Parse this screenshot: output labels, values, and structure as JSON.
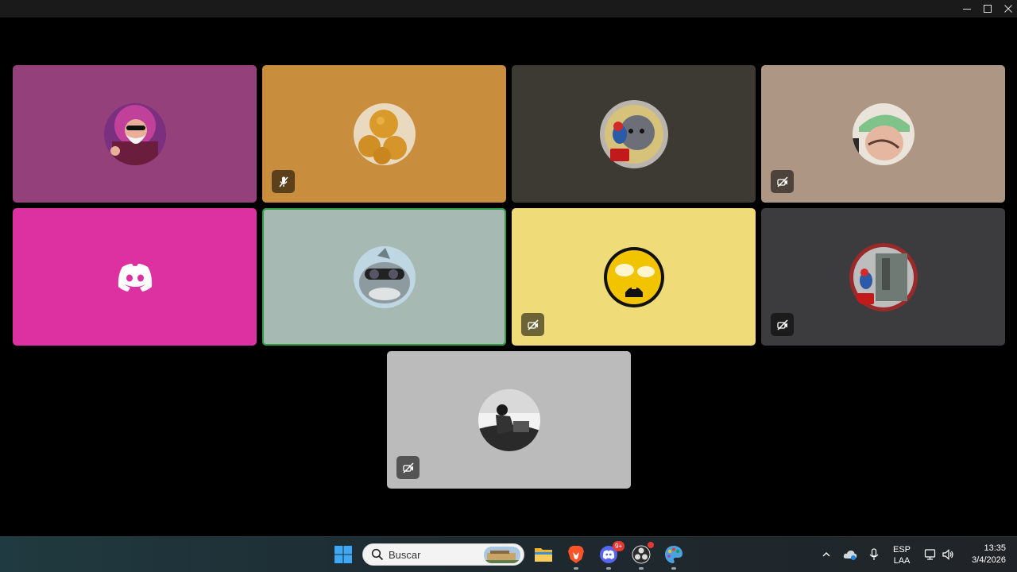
{
  "window": {
    "controls": [
      "minimize",
      "maximize",
      "close"
    ],
    "icons": {
      "minimize": "minimize-icon",
      "maximize": "maximize-icon",
      "close": "close-icon"
    }
  },
  "call": {
    "participants": [
      {
        "id": "p1",
        "tile_color": "#94407b",
        "avatar": "old-master-with-sunglasses",
        "mic_muted": false,
        "camera_off": false,
        "speaking": false
      },
      {
        "id": "p2",
        "tile_color": "#c98e3d",
        "avatar": "fried-balls",
        "mic_muted": true,
        "camera_off": false,
        "speaking": false
      },
      {
        "id": "p3",
        "tile_color": "#3d3a33",
        "avatar": "gray-cat-with-mario",
        "mic_muted": false,
        "camera_off": false,
        "speaking": false
      },
      {
        "id": "p4",
        "tile_color": "#ad9684",
        "avatar": "person-with-cap",
        "mic_muted": false,
        "camera_off": true,
        "speaking": false
      },
      {
        "id": "p5",
        "tile_color": "#dd31a2",
        "avatar": "discord-logo",
        "mic_muted": false,
        "camera_off": false,
        "speaking": false
      },
      {
        "id": "p6",
        "tile_color": "#a7b9b3",
        "avatar": "shark-with-goggles",
        "mic_muted": false,
        "camera_off": false,
        "speaking": true
      },
      {
        "id": "p7",
        "tile_color": "#efdc79",
        "avatar": "smiley-with-glasses",
        "mic_muted": false,
        "camera_off": true,
        "speaking": false
      },
      {
        "id": "p8",
        "tile_color": "#3c3c3f",
        "avatar": "mario-framed-portrait",
        "mic_muted": false,
        "camera_off": true,
        "speaking": false
      },
      {
        "id": "p9",
        "tile_color": "#bbbbbb",
        "avatar": "man-sitting-bw",
        "mic_muted": false,
        "camera_off": true,
        "speaking": false
      }
    ]
  },
  "taskbar": {
    "start_icon": "windows-start-icon",
    "search": {
      "placeholder": "Buscar",
      "icon": "search-icon"
    },
    "apps": [
      {
        "name": "file-explorer-icon"
      },
      {
        "name": "brave-browser-icon"
      },
      {
        "name": "discord-icon",
        "badge": "9+"
      },
      {
        "name": "obs-studio-icon"
      },
      {
        "name": "paint-icon"
      }
    ],
    "tray": {
      "chevron": "chevron-up-icon",
      "onedrive": "onedrive-icon",
      "mic": "microphone-icon",
      "lang_line1": "ESP",
      "lang_line2": "LAA",
      "network": "network-icon",
      "volume": "volume-icon"
    },
    "clock": {
      "time": "13:35",
      "date": "3/4/2026"
    }
  }
}
